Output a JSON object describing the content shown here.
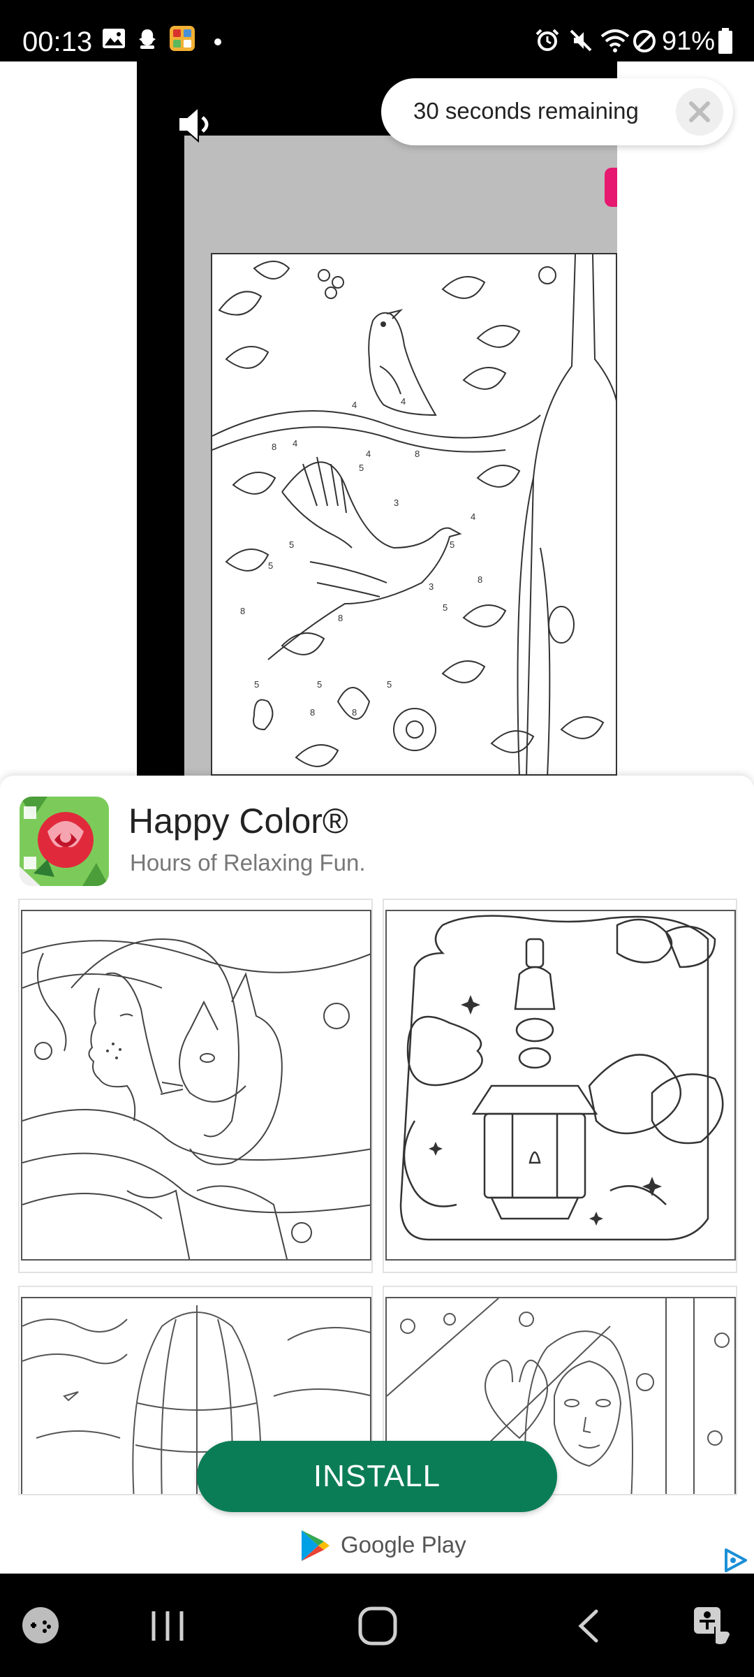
{
  "status_bar": {
    "time": "00:13",
    "battery": "91%",
    "icons": [
      "gallery-icon",
      "snapchat-icon",
      "game-app-icon",
      "dot-icon",
      "alarm-icon",
      "mute-icon",
      "wifi-icon",
      "do-not-disturb-icon",
      "battery-icon"
    ]
  },
  "ad": {
    "timer_text": "30 seconds remaining",
    "close_icon": "close-icon",
    "mute_icon": "speaker-muted-icon"
  },
  "app": {
    "name": "Happy Color®",
    "tagline": "Hours of Relaxing Fun.",
    "install_label": "INSTALL",
    "store_label": "Google Play"
  },
  "colors": {
    "install_green": "#0b7d56",
    "accent_pink": "#e6186f",
    "status_bar": "#000000"
  },
  "navigation": {
    "buttons": [
      "game-tools-icon",
      "recents-icon",
      "home-icon",
      "back-icon",
      "accessibility-icon"
    ]
  }
}
